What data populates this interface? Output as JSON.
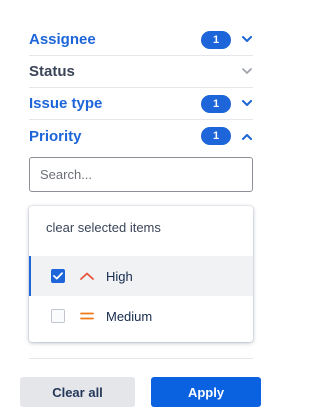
{
  "filters": [
    {
      "label": "Assignee",
      "count": "1",
      "expanded": false,
      "active": true
    },
    {
      "label": "Status",
      "count": "",
      "expanded": false,
      "active": false
    },
    {
      "label": "Issue type",
      "count": "1",
      "expanded": false,
      "active": true
    },
    {
      "label": "Priority",
      "count": "1",
      "expanded": true,
      "active": true
    }
  ],
  "search": {
    "placeholder": "Search...",
    "value": ""
  },
  "dropdown": {
    "clear_label": "clear selected items",
    "options": [
      {
        "label": "High",
        "checked": true,
        "icon": "priority-high-icon"
      },
      {
        "label": "Medium",
        "checked": false,
        "icon": "priority-medium-icon"
      }
    ]
  },
  "footer": {
    "clear_all_label": "Clear all",
    "apply_label": "Apply"
  },
  "colors": {
    "accent": "#1d65d8",
    "apply_button": "#0b62e0",
    "priority_high": "#e8543e",
    "priority_medium": "#f07a1a",
    "muted_text": "#3b4558"
  }
}
